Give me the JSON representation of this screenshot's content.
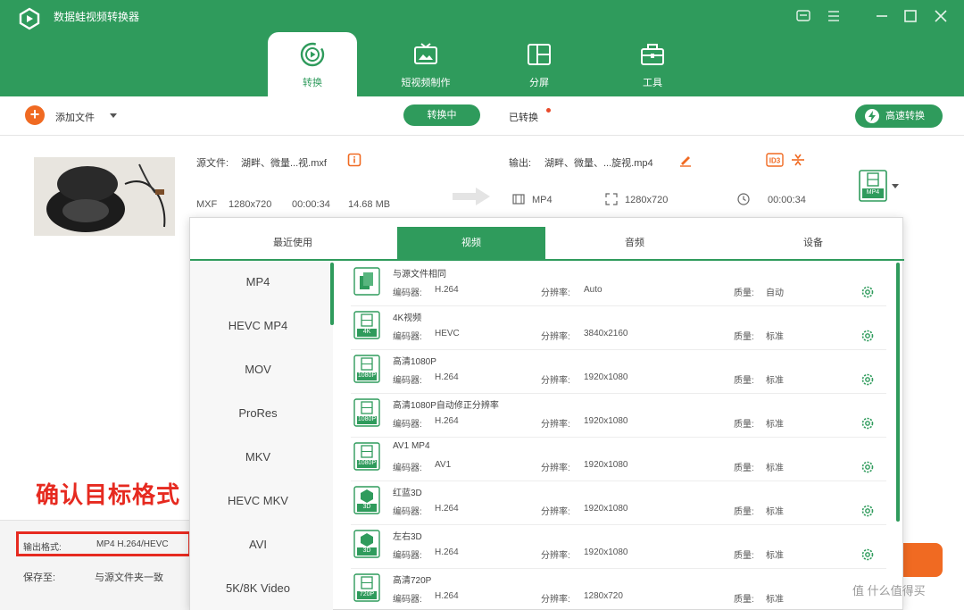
{
  "app": {
    "title": "数据蛙视频转换器"
  },
  "main_tabs": [
    {
      "label": "转换",
      "icon": "convert-icon"
    },
    {
      "label": "短视频制作",
      "icon": "tv-icon"
    },
    {
      "label": "分屏",
      "icon": "split-screen-icon"
    },
    {
      "label": "工具",
      "icon": "toolbox-icon"
    }
  ],
  "toolbar": {
    "add_file": "添加文件",
    "converting": "转换中",
    "converted": "已转换",
    "fast_convert": "高速转换"
  },
  "file": {
    "source_label": "源文件:",
    "source_name": "湖畔、微量...视.mxf",
    "output_label": "输出:",
    "output_name": "湖畔、微量、...旋视.mp4",
    "src_format": "MXF",
    "src_resolution": "1280x720",
    "src_duration": "00:00:34",
    "src_size": "14.68 MB",
    "out_format": "MP4",
    "out_resolution": "1280x720",
    "out_duration": "00:00:34",
    "out_badge": "MP4"
  },
  "bottom": {
    "output_format_label": "输出格式:",
    "output_format_value": "MP4 H.264/HEVC",
    "save_to_label": "保存至:",
    "save_to_value": "与源文件夹一致"
  },
  "annotation": "确认目标格式",
  "popup": {
    "tabs": [
      "最近使用",
      "视频",
      "音频",
      "设备"
    ],
    "formats": [
      "MP4",
      "HEVC MP4",
      "MOV",
      "ProRes",
      "MKV",
      "HEVC MKV",
      "AVI",
      "5K/8K Video"
    ],
    "encoder_label": "编码器:",
    "resolution_label": "分辨率:",
    "quality_label": "质量:",
    "presets": [
      {
        "name": "与源文件相同",
        "badge": "",
        "encoder": "H.264",
        "resolution": "Auto",
        "quality": "自动"
      },
      {
        "name": "4K视频",
        "badge": "4K",
        "encoder": "HEVC",
        "resolution": "3840x2160",
        "quality": "标准"
      },
      {
        "name": "高清1080P",
        "badge": "1080P",
        "encoder": "H.264",
        "resolution": "1920x1080",
        "quality": "标准"
      },
      {
        "name": "高清1080P自动修正分辨率",
        "badge": "1080P",
        "encoder": "H.264",
        "resolution": "1920x1080",
        "quality": "标准"
      },
      {
        "name": "AV1 MP4",
        "badge": "1080P",
        "encoder": "AV1",
        "resolution": "1920x1080",
        "quality": "标准"
      },
      {
        "name": "红蓝3D",
        "badge": "3D",
        "encoder": "H.264",
        "resolution": "1920x1080",
        "quality": "标准"
      },
      {
        "name": "左右3D",
        "badge": "3D",
        "encoder": "H.264",
        "resolution": "1920x1080",
        "quality": "标准"
      },
      {
        "name": "高清720P",
        "badge": "720P",
        "encoder": "H.264",
        "resolution": "1280x720",
        "quality": "标准"
      }
    ]
  },
  "watermark": "值 什么值得买",
  "colors": {
    "primary": "#2f9b5c",
    "accent": "#f06a22",
    "annotation": "#e62a20"
  }
}
